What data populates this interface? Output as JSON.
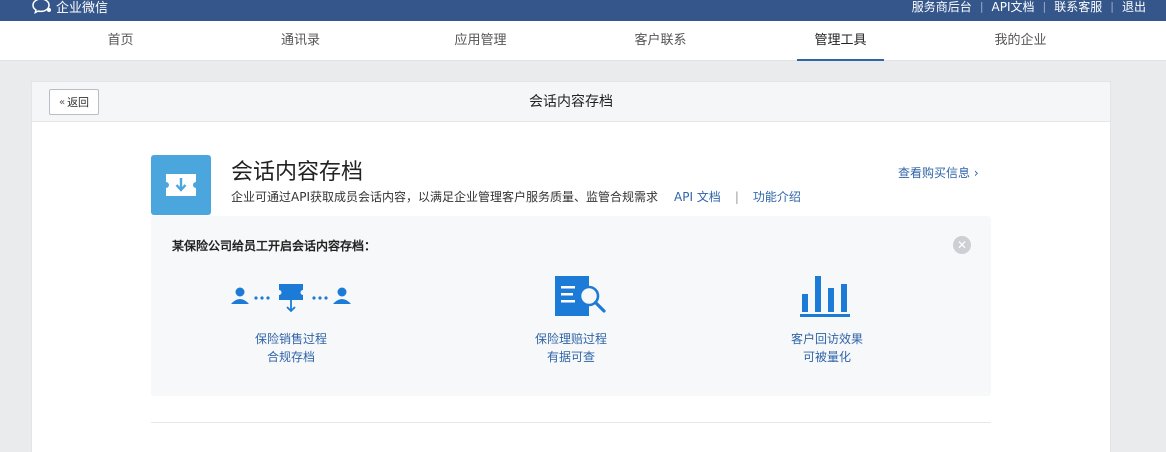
{
  "topbar": {
    "brand": "企业微信",
    "links": [
      "服务商后台",
      "API文档",
      "联系客服",
      "退出"
    ]
  },
  "nav": {
    "items": [
      "首页",
      "通讯录",
      "应用管理",
      "客户联系",
      "管理工具",
      "我的企业"
    ],
    "active": "管理工具"
  },
  "card": {
    "back_label": "返回",
    "title": "会话内容存档"
  },
  "app": {
    "name": "会话内容存档",
    "description": "企业可通过API获取成员会话内容，以满足企业管理客户服务质量、监管合规需求",
    "api_doc_link": "API 文档",
    "separator": "|",
    "intro_link": "功能介绍",
    "buy_link": "查看购买信息"
  },
  "case": {
    "title": "某保险公司给员工开启会话内容存档：",
    "items": [
      {
        "line1": "保险销售过程",
        "line2": "合规存档",
        "icon": "people-archive-icon"
      },
      {
        "line1": "保险理赔过程",
        "line2": "有据可查",
        "icon": "document-search-icon"
      },
      {
        "line1": "客户回访效果",
        "line2": "可被量化",
        "icon": "bar-chart-icon"
      }
    ]
  },
  "colors": {
    "topbar": "#34568b",
    "accent": "#2f64a8",
    "icon_blue": "#1d7bd8",
    "app_icon": "#4aa6dd"
  }
}
